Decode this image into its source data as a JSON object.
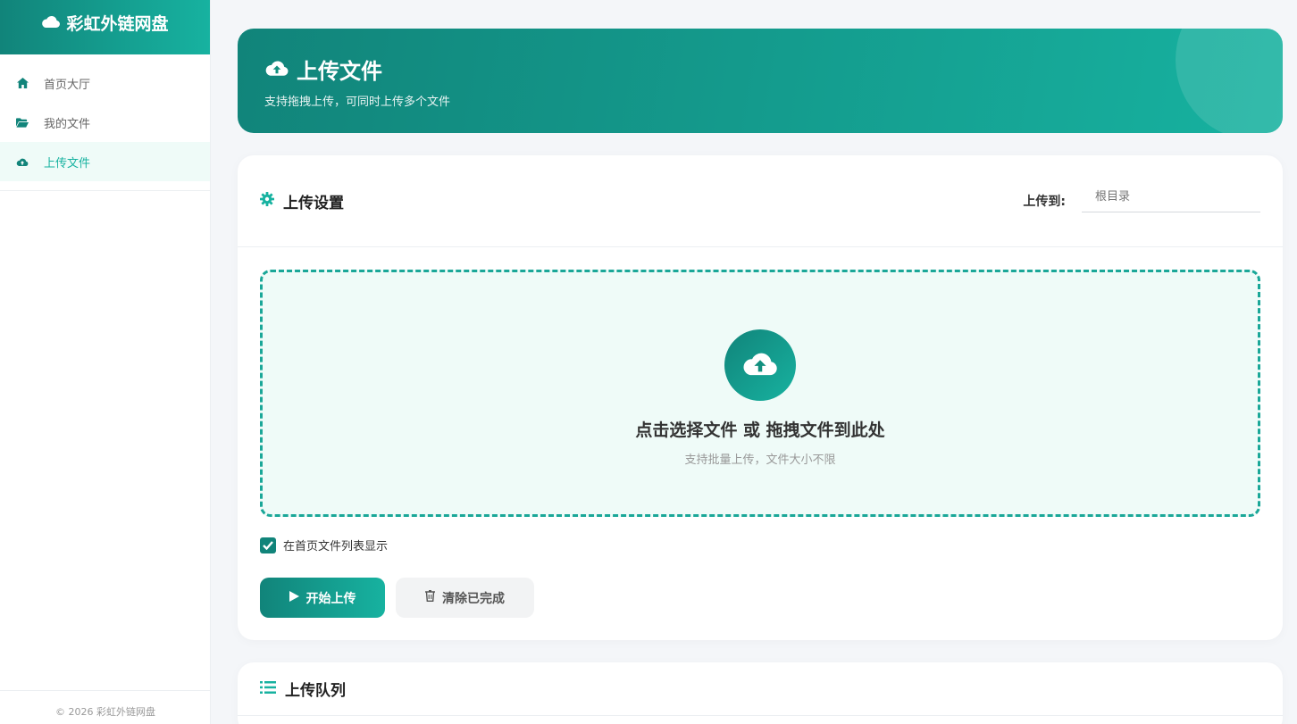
{
  "brand": {
    "title": "彩虹外链网盘"
  },
  "sidebar": {
    "items": [
      {
        "label": "首页大厅",
        "icon": "home-icon"
      },
      {
        "label": "我的文件",
        "icon": "folder-open-icon"
      },
      {
        "label": "上传文件",
        "icon": "cloud-upload-icon",
        "active": true
      }
    ],
    "footer": "© 2026 彩虹外链网盘"
  },
  "hero": {
    "title": "上传文件",
    "subtitle": "支持拖拽上传，可同时上传多个文件"
  },
  "settings": {
    "title": "上传设置",
    "upload_to_label": "上传到:",
    "dir_placeholder": "根目录"
  },
  "dropzone": {
    "title": "点击选择文件 或 拖拽文件到此处",
    "subtitle": "支持批量上传，文件大小不限"
  },
  "options": {
    "show_on_home_label": "在首页文件列表显示",
    "show_on_home_checked": true
  },
  "actions": {
    "start_label": "开始上传",
    "clear_label": "清除已完成"
  },
  "queue": {
    "title": "上传队列"
  },
  "colors": {
    "accent": "#11847a",
    "accent_light": "#17b2a0",
    "zone_bg": "#effbf8"
  }
}
